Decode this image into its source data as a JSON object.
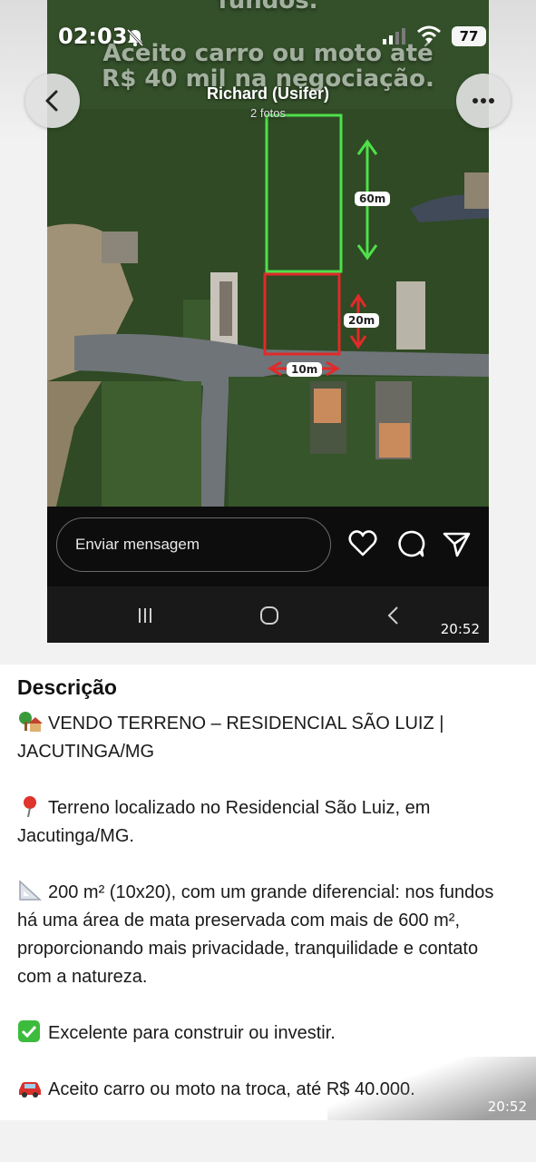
{
  "status_bar": {
    "time": "02:03",
    "battery": "77"
  },
  "header": {
    "title": "Richard (Usifer)",
    "subtitle": "2 fotos"
  },
  "embedded_screenshot": {
    "overlay_text": [
      "fundos.",
      "Aceito carro ou moto até",
      "R$ 40 mil na negociação."
    ],
    "dimensions": {
      "depth_back": "60m",
      "depth_front": "20m",
      "width": "10m"
    },
    "message_placeholder": "Enviar mensagem",
    "timestamp": "20:52"
  },
  "description": {
    "title": "Descrição",
    "paragraphs": [
      {
        "icon": "house-tree-icon",
        "text": "VENDO TERRENO – RESIDENCIAL SÃO LUIZ | JACUTINGA/MG"
      },
      {
        "icon": "pin-icon",
        "text": "Terreno localizado no Residencial São Luiz, em Jacutinga/MG."
      },
      {
        "icon": "triangle-ruler-icon",
        "text": "200 m² (10x20), com um grande diferencial: nos fundos há uma área de mata preservada com mais de 600 m², proporcionando mais privacidade, tranquilidade e contato com a natureza."
      },
      {
        "icon": "check-icon",
        "text": "Excelente para construir ou investir."
      },
      {
        "icon": "car-icon",
        "text": "Aceito carro ou moto na troca, até R$ 40.000."
      }
    ],
    "timestamp": "20:52"
  },
  "colors": {
    "green_outline": "#4ee04a",
    "red_outline": "#e02a2a",
    "accent_check": "#3dbb3d"
  }
}
